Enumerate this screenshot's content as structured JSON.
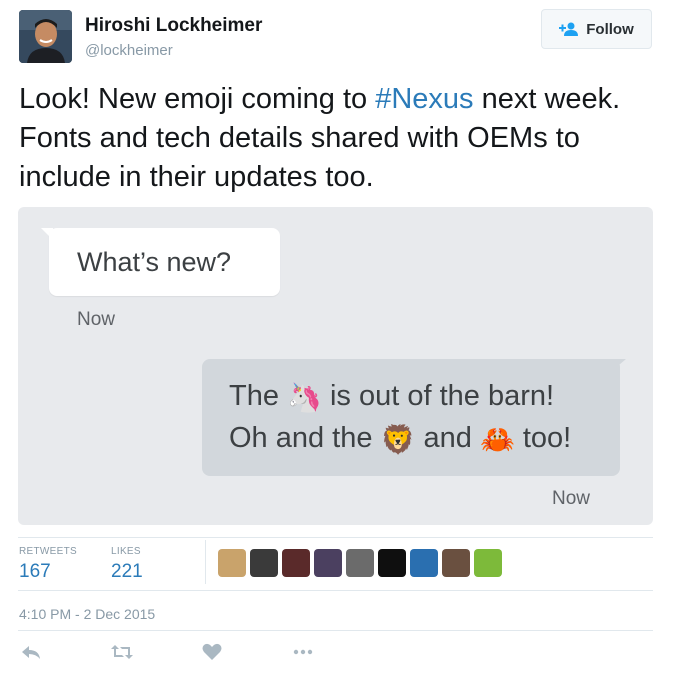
{
  "user": {
    "name": "Hiroshi Lockheimer",
    "handle": "@lockheimer"
  },
  "follow_label": "Follow",
  "tweet": {
    "text_before": "Look! New emoji coming to ",
    "hashtag": "#Nexus",
    "text_after": " next week. Fonts and tech details shared with OEMs to include in their updates too."
  },
  "media": {
    "incoming_message": "What’s new?",
    "incoming_time": "Now",
    "outgoing_line1_a": "The ",
    "outgoing_emoji_unicorn": "🦄",
    "outgoing_line1_b": " is out of the barn!",
    "outgoing_line2_a": "Oh and the ",
    "outgoing_emoji_lion": "🦁",
    "outgoing_line2_b": " and ",
    "outgoing_emoji_crab": "🦀",
    "outgoing_line2_c": " too!",
    "outgoing_time": "Now"
  },
  "stats": {
    "retweets_label": "RETWEETS",
    "retweets_count": "167",
    "likes_label": "LIKES",
    "likes_count": "221"
  },
  "likers_avatar_colors": [
    "#c9a36b",
    "#3a3a3a",
    "#5a2a2a",
    "#4b4060",
    "#6b6b6b",
    "#0f0f0f",
    "#2a6fb0",
    "#6a5040",
    "#7dba3a"
  ],
  "timestamp": "4:10 PM - 2 Dec 2015",
  "icons": [
    "reply-icon",
    "retweet-icon",
    "like-icon",
    "more-icon"
  ],
  "colors": {
    "link": "#2b7bb9",
    "muted": "#8899a6",
    "bubble_out": "#d2d7dc",
    "media_bg": "#e8eaed"
  }
}
